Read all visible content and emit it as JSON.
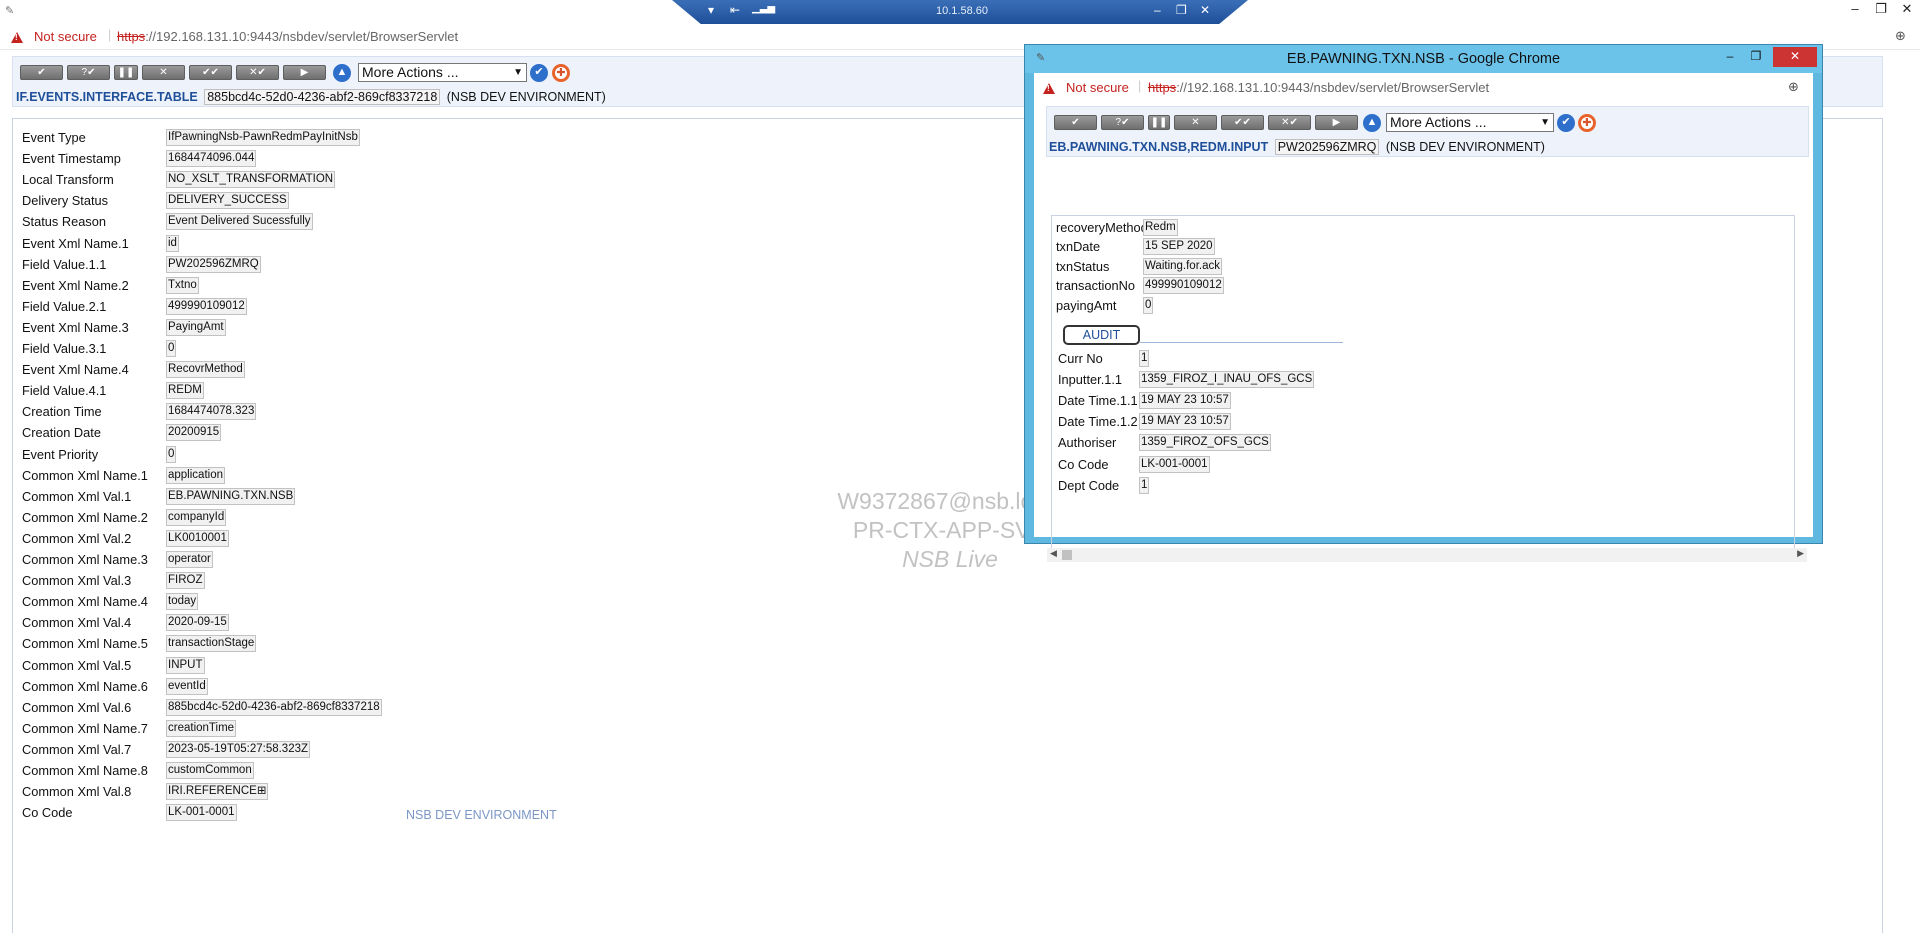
{
  "citrix": {
    "ip": "10.1.58.60"
  },
  "main": {
    "address": {
      "not_secure": "Not secure",
      "url_scheme": "https",
      "url_rest": "://192.168.131.10:9443/nsbdev/servlet/BrowserServlet"
    },
    "toolbar": {
      "more_actions": "More Actions ..."
    },
    "app_name": "IF.EVENTS.INTERFACE.TABLE",
    "record_id": "885bcd4c-52d0-4236-abf2-869cf8337218",
    "environment": "(NSB DEV ENVIRONMENT)",
    "footer_env": "NSB DEV ENVIRONMENT",
    "fields": [
      {
        "label": "Event Type",
        "value": "IfPawningNsb-PawnRedmPayInitNsb"
      },
      {
        "label": "Event Timestamp",
        "value": "1684474096.044"
      },
      {
        "label": "Local Transform",
        "value": "NO_XSLT_TRANSFORMATION"
      },
      {
        "label": "Delivery Status",
        "value": "DELIVERY_SUCCESS"
      },
      {
        "label": "Status Reason",
        "value": "Event Delivered Sucessfully"
      },
      {
        "label": "Event Xml Name.1",
        "value": "id"
      },
      {
        "label": "Field Value.1.1",
        "value": "PW202596ZMRQ"
      },
      {
        "label": "Event Xml Name.2",
        "value": "Txtno"
      },
      {
        "label": "Field Value.2.1",
        "value": "499990109012"
      },
      {
        "label": "Event Xml Name.3",
        "value": "PayingAmt"
      },
      {
        "label": "Field Value.3.1",
        "value": "0"
      },
      {
        "label": "Event Xml Name.4",
        "value": "RecovrMethod"
      },
      {
        "label": "Field Value.4.1",
        "value": "REDM"
      },
      {
        "label": "Creation Time",
        "value": "1684474078.323"
      },
      {
        "label": "Creation Date",
        "value": "20200915"
      },
      {
        "label": "Event Priority",
        "value": "0"
      },
      {
        "label": "Common Xml Name.1",
        "value": "application"
      },
      {
        "label": "Common Xml Val.1",
        "value": "EB.PAWNING.TXN.NSB"
      },
      {
        "label": "Common Xml Name.2",
        "value": "companyId"
      },
      {
        "label": "Common Xml Val.2",
        "value": "LK0010001"
      },
      {
        "label": "Common Xml Name.3",
        "value": "operator"
      },
      {
        "label": "Common Xml Val.3",
        "value": "FIROZ"
      },
      {
        "label": "Common Xml Name.4",
        "value": "today"
      },
      {
        "label": "Common Xml Val.4",
        "value": "2020-09-15"
      },
      {
        "label": "Common Xml Name.5",
        "value": "transactionStage"
      },
      {
        "label": "Common Xml Val.5",
        "value": "INPUT"
      },
      {
        "label": "Common Xml Name.6",
        "value": "eventId"
      },
      {
        "label": "Common Xml Val.6",
        "value": "885bcd4c-52d0-4236-abf2-869cf8337218"
      },
      {
        "label": "Common Xml Name.7",
        "value": "creationTime"
      },
      {
        "label": "Common Xml Val.7",
        "value": "2023-05-19T05:27:58.323Z"
      },
      {
        "label": "Common Xml Name.8",
        "value": "customCommon"
      },
      {
        "label": "Common Xml Val.8",
        "value": "IRI.REFERENCE⊞"
      },
      {
        "label": "Co Code",
        "value": "LK-001-0001"
      }
    ]
  },
  "watermark": [
    "W9372867@nsb.local",
    "PR-CTX-APP-SVR",
    "NSB Live"
  ],
  "popup": {
    "title": "EB.PAWNING.TXN.NSB - Google Chrome",
    "address": {
      "not_secure": "Not secure",
      "url_scheme": "https",
      "url_rest": "://192.168.131.10:9443/nsbdev/servlet/BrowserServlet"
    },
    "toolbar": {
      "more_actions": "More Actions ..."
    },
    "app_name": "EB.PAWNING.TXN.NSB,REDM.INPUT",
    "record_id": "PW202596ZMRQ",
    "environment": "(NSB DEV ENVIRONMENT)",
    "fields": [
      {
        "label": "recoveryMethod",
        "value": "Redm"
      },
      {
        "label": "txnDate",
        "value": "15 SEP 2020"
      },
      {
        "label": "txnStatus",
        "value": "Waiting.for.ack"
      },
      {
        "label": "transactionNo",
        "value": "499990109012"
      },
      {
        "label": "payingAmt",
        "value": "0"
      }
    ],
    "audit_tab": "AUDIT",
    "audit_fields": [
      {
        "label": "Curr No",
        "value": "1"
      },
      {
        "label": "Inputter.1.1",
        "value": "1359_FIROZ_I_INAU_OFS_GCS"
      },
      {
        "label": "Date Time.1.1",
        "value": "19 MAY 23 10:57"
      },
      {
        "label": "Date Time.1.2",
        "value": "19 MAY 23 10:57"
      },
      {
        "label": "Authoriser",
        "value": "1359_FIROZ_OFS_GCS"
      },
      {
        "label": "Co Code",
        "value": "LK-001-0001"
      },
      {
        "label": "Dept Code",
        "value": "1"
      }
    ]
  }
}
